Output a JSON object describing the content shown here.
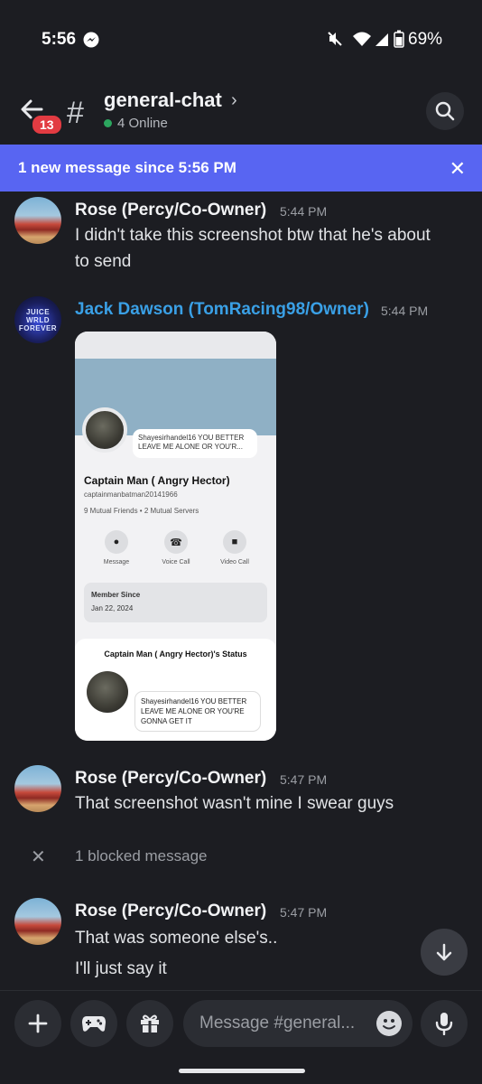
{
  "status_bar": {
    "time": "5:56",
    "battery": "69%"
  },
  "header": {
    "unread_badge": "13",
    "channel_name": "general-chat",
    "online_count": "4 Online"
  },
  "banner": {
    "text": "1 new message since 5:56 PM"
  },
  "messages": [
    {
      "author": "Rose (Percy/Co-Owner)",
      "time": "5:44 PM",
      "lines": [
        "I didn't take this screenshot btw that he's about",
        "to send"
      ]
    },
    {
      "author": "Jack Dawson (TomRacing98/Owner)",
      "time": "5:44 PM",
      "avatar_text": "JUICE WRLD FOREVER"
    },
    {
      "author": "Rose (Percy/Co-Owner)",
      "time": "5:47 PM",
      "lines": [
        "That screenshot wasn't mine I swear guys"
      ]
    },
    {
      "author": "Rose (Percy/Co-Owner)",
      "time": "5:47 PM",
      "lines": [
        "That was someone else's..",
        "I'll just say it"
      ]
    }
  ],
  "attachment": {
    "status_text": "Shayesirhandel16 YOU BETTER LEAVE ME ALONE OR YOU'R...",
    "display_name": "Captain Man ( Angry Hector)",
    "username": "captainmanbatman20141966",
    "mutual": "9 Mutual Friends  •  2 Mutual Servers",
    "actions": [
      "Message",
      "Voice Call",
      "Video Call"
    ],
    "member_since_label": "Member Since",
    "member_since_date": "Jan 22, 2024",
    "sheet_title": "Captain Man ( Angry Hector)'s Status",
    "sheet_status": "Shayesirhandel16 YOU BETTER LEAVE ME ALONE OR YOU'RE GONNA GET IT"
  },
  "blocked": {
    "text": "1 blocked message"
  },
  "composer": {
    "placeholder": "Message #general..."
  },
  "colors": {
    "accent": "#5865f2",
    "owner_name": "#3aa0e6",
    "badge": "#e23b42",
    "online": "#2ca65f"
  },
  "icons": [
    "messenger-icon",
    "mute-icon",
    "wifi-icon",
    "signal-icon",
    "battery-icon",
    "back-arrow-icon",
    "search-icon",
    "close-icon",
    "plus-icon",
    "gamepad-icon",
    "gift-icon",
    "emoji-icon",
    "mic-icon",
    "arrow-down-icon"
  ]
}
